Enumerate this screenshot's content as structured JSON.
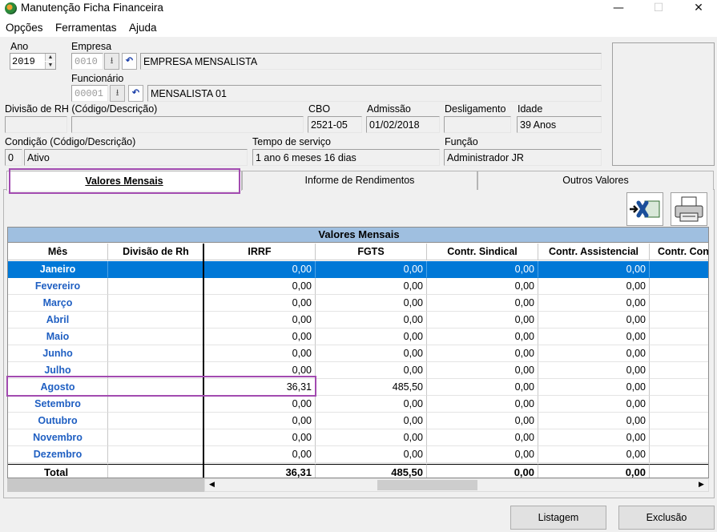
{
  "window": {
    "title": "Manutenção Ficha Financeira",
    "minimize": "—",
    "maximize": "☐",
    "close": "✕"
  },
  "menu": [
    "Opções",
    "Ferramentas",
    "Ajuda"
  ],
  "form": {
    "ano_label": "Ano",
    "ano_value": "2019",
    "empresa_label": "Empresa",
    "empresa_code": "0010",
    "empresa_name": "EMPRESA MENSALISTA",
    "funcionario_label": "Funcionário",
    "funcionario_code": "00001",
    "funcionario_name": "MENSALISTA 01",
    "divisao_label": "Divisão de RH (Código/Descrição)",
    "divisao_code": "",
    "divisao_desc": "",
    "cbo_label": "CBO",
    "cbo_value": "2521-05",
    "admissao_label": "Admissão",
    "admissao_value": "01/02/2018",
    "desligamento_label": "Desligamento",
    "desligamento_value": "",
    "idade_label": "Idade",
    "idade_value": "39 Anos",
    "condicao_label": "Condição (Código/Descrição)",
    "condicao_code": "0",
    "condicao_desc": "Ativo",
    "tempo_label": "Tempo de serviço",
    "tempo_value": "1 ano 6 meses 16 dias",
    "funcao_label": "Função",
    "funcao_value": "Administrador JR"
  },
  "icons": {
    "download": "⭳",
    "undo": "↶",
    "spin_up": "▲",
    "spin_down": "▼",
    "scroll_left": "◀",
    "scroll_right": "▶"
  },
  "tabs": {
    "t1": "Valores Mensais",
    "t2": "Informe de Rendimentos",
    "t3": "Outros Valores"
  },
  "grid": {
    "title": "Valores Mensais",
    "columns": [
      "Mês",
      "Divisão de Rh",
      "IRRF",
      "FGTS",
      "Contr. Sindical",
      "Contr. Assistencial",
      "Contr. Con"
    ],
    "rows": [
      {
        "mes": "Janeiro",
        "divisao": "",
        "irrf": "0,00",
        "fgts": "0,00",
        "sindical": "0,00",
        "assistencial": "0,00"
      },
      {
        "mes": "Fevereiro",
        "divisao": "",
        "irrf": "0,00",
        "fgts": "0,00",
        "sindical": "0,00",
        "assistencial": "0,00"
      },
      {
        "mes": "Março",
        "divisao": "",
        "irrf": "0,00",
        "fgts": "0,00",
        "sindical": "0,00",
        "assistencial": "0,00"
      },
      {
        "mes": "Abril",
        "divisao": "",
        "irrf": "0,00",
        "fgts": "0,00",
        "sindical": "0,00",
        "assistencial": "0,00"
      },
      {
        "mes": "Maio",
        "divisao": "",
        "irrf": "0,00",
        "fgts": "0,00",
        "sindical": "0,00",
        "assistencial": "0,00"
      },
      {
        "mes": "Junho",
        "divisao": "",
        "irrf": "0,00",
        "fgts": "0,00",
        "sindical": "0,00",
        "assistencial": "0,00"
      },
      {
        "mes": "Julho",
        "divisao": "",
        "irrf": "0,00",
        "fgts": "0,00",
        "sindical": "0,00",
        "assistencial": "0,00"
      },
      {
        "mes": "Agosto",
        "divisao": "",
        "irrf": "36,31",
        "fgts": "485,50",
        "sindical": "0,00",
        "assistencial": "0,00"
      },
      {
        "mes": "Setembro",
        "divisao": "",
        "irrf": "0,00",
        "fgts": "0,00",
        "sindical": "0,00",
        "assistencial": "0,00"
      },
      {
        "mes": "Outubro",
        "divisao": "",
        "irrf": "0,00",
        "fgts": "0,00",
        "sindical": "0,00",
        "assistencial": "0,00"
      },
      {
        "mes": "Novembro",
        "divisao": "",
        "irrf": "0,00",
        "fgts": "0,00",
        "sindical": "0,00",
        "assistencial": "0,00"
      },
      {
        "mes": "Dezembro",
        "divisao": "",
        "irrf": "0,00",
        "fgts": "0,00",
        "sindical": "0,00",
        "assistencial": "0,00"
      }
    ],
    "total": {
      "mes": "Total",
      "irrf": "36,31",
      "fgts": "485,50",
      "sindical": "0,00",
      "assistencial": "0,00"
    }
  },
  "buttons": {
    "listagem": "Listagem",
    "exclusao": "Exclusão"
  }
}
